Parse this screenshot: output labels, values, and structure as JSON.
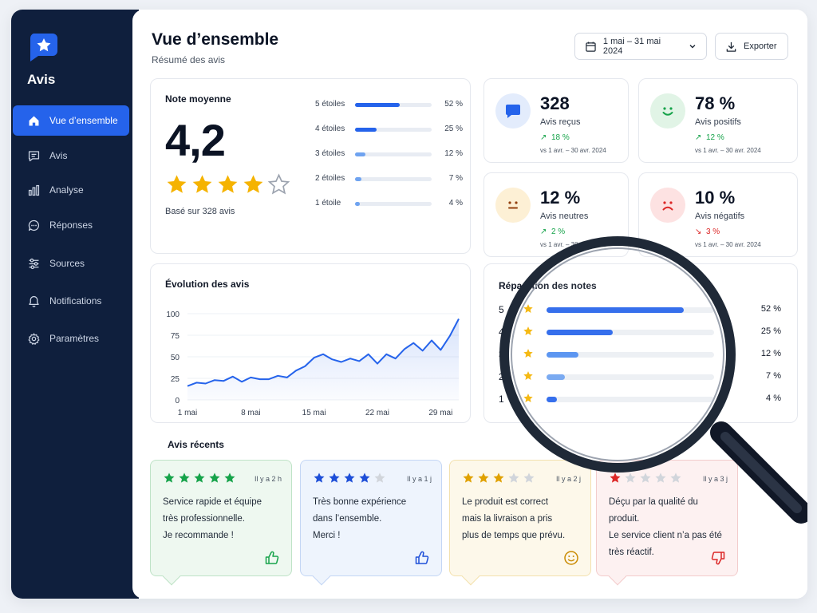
{
  "sidebar": {
    "brand": "Avis",
    "items": [
      {
        "label": "Vue d’ensemble",
        "icon": "home-icon"
      },
      {
        "label": "Avis",
        "icon": "message-icon"
      },
      {
        "label": "Analyse",
        "icon": "bar-chart-icon"
      },
      {
        "label": "Réponses",
        "icon": "chat-bubble-icon"
      },
      {
        "label": "Sources",
        "icon": "sources-icon"
      },
      {
        "label": "Notifications",
        "icon": "bell-icon"
      },
      {
        "label": "Paramètres",
        "icon": "gear-icon"
      }
    ]
  },
  "header": {
    "title": "Vue d’ensemble",
    "subtitle": "Résumé des avis",
    "date_range": "1 mai – 31 mai 2024",
    "export_label": "Exporter"
  },
  "rating": {
    "title": "Note moyenne",
    "average": "4,2",
    "stars": 4,
    "based_on": "Basé sur 328 avis",
    "distribution": [
      {
        "label": "5 étoiles",
        "pct": "52 %",
        "value": 52
      },
      {
        "label": "4 étoiles",
        "pct": "25 %",
        "value": 25
      },
      {
        "label": "3 étoiles",
        "pct": "12 %",
        "value": 12
      },
      {
        "label": "2 étoiles",
        "pct": "7 %",
        "value": 7
      },
      {
        "label": "1 étoile",
        "pct": "4 %",
        "value": 4
      }
    ]
  },
  "stats": [
    {
      "value": "328",
      "label": "Avis reçus",
      "delta": "18 %",
      "direction": "up",
      "period": "vs 1 avr. – 30 avr. 2024",
      "icon": "chat-bubble-icon",
      "color": "#2563eb",
      "bg": "#e3ecfc"
    },
    {
      "value": "78 %",
      "label": "Avis positifs",
      "delta": "12 %",
      "direction": "up",
      "period": "vs 1 avr. – 30 avr. 2024",
      "icon": "happy-face-icon",
      "color": "#16a34a",
      "bg": "#e1f4e6"
    },
    {
      "value": "12 %",
      "label": "Avis neutres",
      "delta": "2 %",
      "direction": "up",
      "period": "vs 1 avr. – 30 avr. 2024",
      "icon": "neutral-face-icon",
      "color": "#b45309",
      "bg": "#fdf0d5"
    },
    {
      "value": "10 %",
      "label": "Avis négatifs",
      "delta": "3 %",
      "direction": "down",
      "period": "vs 1 avr. – 30 avr. 2024",
      "icon": "sad-face-icon",
      "color": "#dc2626",
      "bg": "#fde2e2"
    }
  ],
  "chart_data": [
    {
      "type": "area",
      "title": "Évolution des avis",
      "x_ticks": [
        "1 mai",
        "8 mai",
        "15 mai",
        "22 mai",
        "29 mai"
      ],
      "y_ticks": [
        0,
        25,
        50,
        75,
        100
      ],
      "ylim": [
        0,
        100
      ],
      "xlim": [
        1,
        31
      ],
      "grid": true,
      "x": [
        1,
        2,
        3,
        4,
        5,
        6,
        7,
        8,
        9,
        10,
        11,
        12,
        13,
        14,
        15,
        16,
        17,
        18,
        19,
        20,
        21,
        22,
        23,
        24,
        25,
        26,
        27,
        28,
        29,
        30,
        31
      ],
      "values": [
        16,
        20,
        19,
        23,
        22,
        27,
        21,
        26,
        24,
        24,
        28,
        26,
        34,
        39,
        49,
        53,
        47,
        44,
        48,
        45,
        53,
        42,
        53,
        48,
        59,
        66,
        57,
        69,
        58,
        74,
        94
      ]
    },
    {
      "type": "bar",
      "title": "Répartition des notes",
      "categories": [
        "5",
        "4",
        "3",
        "2",
        "1"
      ],
      "values": [
        52,
        25,
        12,
        7,
        4
      ],
      "labels": [
        "52 %",
        "25 %",
        "12 %",
        "7 %",
        "4 %"
      ],
      "orientation": "horizontal"
    }
  ],
  "recent": {
    "title": "Avis récents",
    "items": [
      {
        "stars": 5,
        "time": "Il y a 2 h",
        "text": "Service rapide et équipe\ntrès professionnelle.\nJe recommande !",
        "icon": "thumbs-up-icon",
        "accent": "#16a34a",
        "bg": "#eef8f0",
        "border": "#bfe3c7"
      },
      {
        "stars": 4,
        "time": "Il y a 1 j",
        "text": "Très bonne expérience\ndans l’ensemble.\nMerci !",
        "icon": "thumbs-up-icon",
        "accent": "#1d4ed8",
        "bg": "#eef4fd",
        "border": "#c4d6f5"
      },
      {
        "stars": 3,
        "time": "Il y a 2 j",
        "text": "Le produit est correct\nmais la livraison a pris\nplus de temps que prévu.",
        "icon": "neutral-face-icon",
        "accent": "#e0a100",
        "bg": "#fdf8ea",
        "border": "#f3e1ae"
      },
      {
        "stars": 1,
        "time": "Il y a 3 j",
        "text": "Déçu par la qualité du produit.\nLe service client n’a pas été\ntrès réactif.",
        "icon": "thumbs-down-icon",
        "accent": "#dc2626",
        "bg": "#fdf1f1",
        "border": "#f3cccc"
      }
    ]
  }
}
